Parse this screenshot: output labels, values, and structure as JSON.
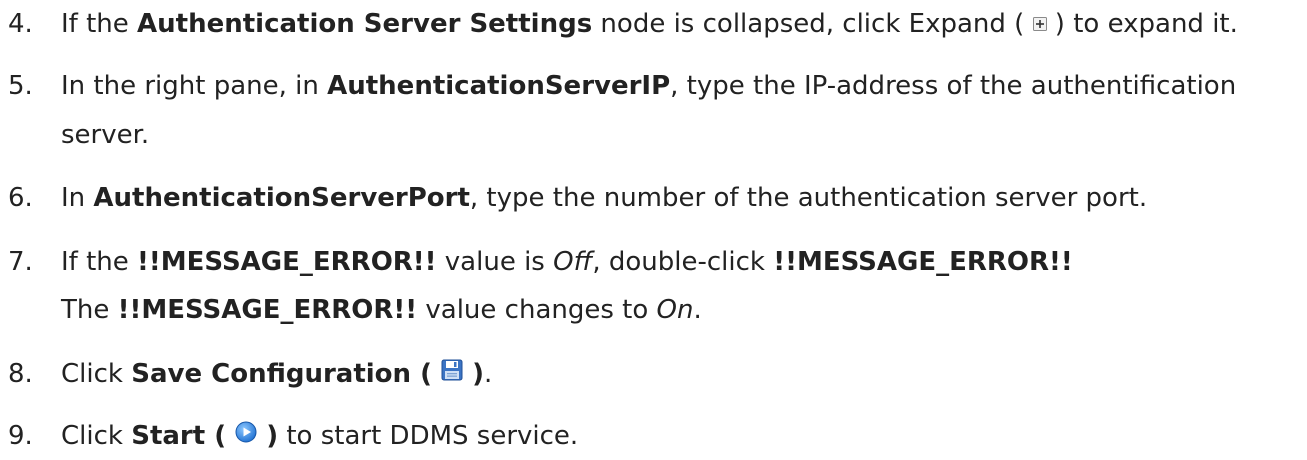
{
  "steps": [
    {
      "number": "4.",
      "lines": [
        {
          "segments": [
            {
              "t": "If the ",
              "s": "n"
            },
            {
              "t": "Authentication Server Settings",
              "s": "b"
            },
            {
              "t": " node is collapsed, click Expand ( ",
              "s": "n"
            },
            {
              "icon": "expand-icon"
            },
            {
              "t": " ) to expand it.",
              "s": "n"
            }
          ]
        }
      ]
    },
    {
      "number": "5.",
      "lines": [
        {
          "segments": [
            {
              "t": "In the right pane, in ",
              "s": "n"
            },
            {
              "t": "AuthenticationServerIP",
              "s": "b"
            },
            {
              "t": ", type the IP-address of the authentification",
              "s": "n"
            }
          ]
        },
        {
          "segments": [
            {
              "t": "server.",
              "s": "n"
            }
          ]
        }
      ]
    },
    {
      "number": "6.",
      "lines": [
        {
          "segments": [
            {
              "t": "In ",
              "s": "n"
            },
            {
              "t": "AuthenticationServerPort",
              "s": "b"
            },
            {
              "t": ", type the number of the authentication server port.",
              "s": "n"
            }
          ]
        }
      ]
    },
    {
      "number": "7.",
      "lines": [
        {
          "segments": [
            {
              "t": "If the ",
              "s": "n"
            },
            {
              "t": "!!MESSAGE_ERROR!!",
              "s": "b"
            },
            {
              "t": " value is ",
              "s": "n"
            },
            {
              "t": "Off",
              "s": "i"
            },
            {
              "t": ", double-click ",
              "s": "n"
            },
            {
              "t": "!!MESSAGE_ERROR!!",
              "s": "b"
            }
          ]
        },
        {
          "segments": [
            {
              "t": "The ",
              "s": "n"
            },
            {
              "t": "!!MESSAGE_ERROR!!",
              "s": "b"
            },
            {
              "t": " value changes to ",
              "s": "n"
            },
            {
              "t": "On",
              "s": "i"
            },
            {
              "t": ".",
              "s": "n"
            }
          ]
        }
      ]
    },
    {
      "number": "8.",
      "lines": [
        {
          "segments": [
            {
              "t": "Click ",
              "s": "n"
            },
            {
              "t": "Save Configuration ( ",
              "s": "b"
            },
            {
              "icon": "save-icon"
            },
            {
              "t": " )",
              "s": "b"
            },
            {
              "t": ".",
              "s": "n"
            }
          ]
        }
      ]
    },
    {
      "number": "9.",
      "lines": [
        {
          "segments": [
            {
              "t": "Click ",
              "s": "n"
            },
            {
              "t": "Start ( ",
              "s": "b"
            },
            {
              "icon": "start-icon"
            },
            {
              "t": " )",
              "s": "b"
            },
            {
              "t": " to start DDMS service.",
              "s": "n"
            }
          ]
        }
      ]
    }
  ]
}
